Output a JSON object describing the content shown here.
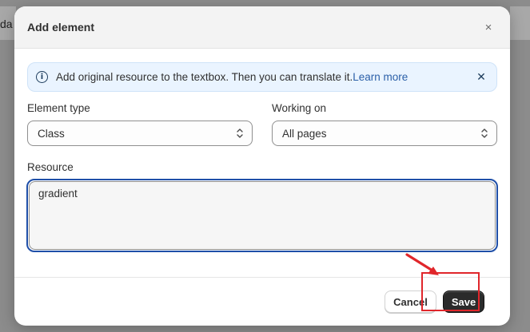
{
  "background": {
    "partial_text": "da"
  },
  "dialog": {
    "title": "Add element",
    "close_symbol": "×"
  },
  "banner": {
    "icon": "info-icon",
    "text": "Add original resource to the textbox. Then you can translate it.",
    "link": "Learn more",
    "dismiss_symbol": "✕"
  },
  "form": {
    "element_type": {
      "label": "Element type",
      "value": "Class"
    },
    "working_on": {
      "label": "Working on",
      "value": "All pages"
    },
    "resource": {
      "label": "Resource",
      "value": "gradient"
    }
  },
  "actions": {
    "cancel": "Cancel",
    "save": "Save"
  },
  "colors": {
    "primary_button": "#2b2b2b",
    "banner_bg": "#eaf4ff",
    "link": "#2b5fa8",
    "focus_ring": "#1f4fa8",
    "annotation_red": "#e0262b"
  }
}
